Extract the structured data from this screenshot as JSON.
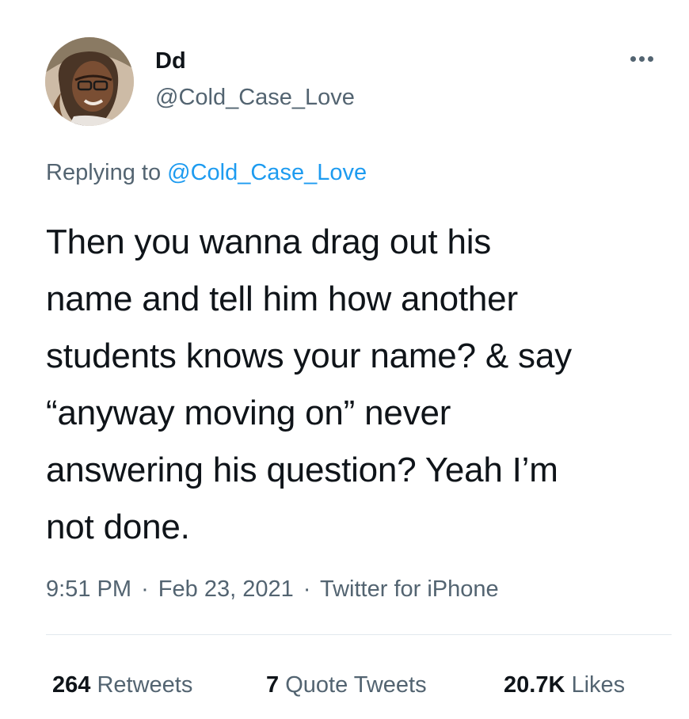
{
  "author": {
    "display_name": "Dd",
    "handle": "@Cold_Case_Love",
    "avatar_icon": "profile-photo"
  },
  "more_icon": "more-horizontal-icon",
  "reply": {
    "prefix": "Replying to ",
    "target": "@Cold_Case_Love"
  },
  "tweet": {
    "text": "Then you wanna drag out his\nname and tell him how another\nstudents knows your name? & say\n“anyway moving on” never\nanswering his question? Yeah I’m\nnot done."
  },
  "meta": {
    "time": "9:51 PM",
    "date": "Feb 23, 2021",
    "source": "Twitter for iPhone",
    "separator": "·"
  },
  "stats": {
    "retweets_count": "264",
    "retweets_label": "Retweets",
    "quotes_count": "7",
    "quotes_label": "Quote Tweets",
    "likes_count": "20.7K",
    "likes_label": "Likes"
  },
  "colors": {
    "text": "#0f1419",
    "secondary": "#536471",
    "link": "#1d9bf0",
    "divider": "#e1e8ed"
  }
}
